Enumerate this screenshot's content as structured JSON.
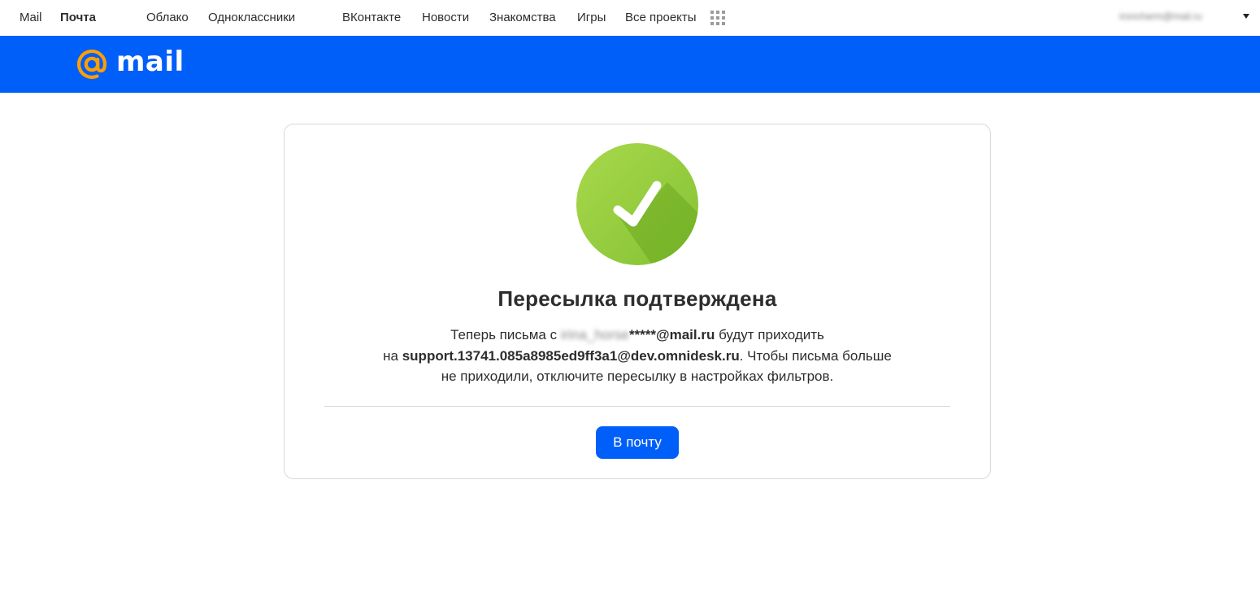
{
  "portal": {
    "links": [
      {
        "label": "Mail"
      },
      {
        "label": "Почта"
      },
      {
        "label": "Облако"
      },
      {
        "label": "Одноклассники"
      },
      {
        "label": "ВКонтакте"
      },
      {
        "label": "Новости"
      },
      {
        "label": "Знакомства"
      },
      {
        "label": "Игры"
      },
      {
        "label": "Все проекты"
      }
    ],
    "projects_icon": "grid-icon",
    "user_email": "ironcharm@mail.ru"
  },
  "header": {
    "logo_text": "mail",
    "logo_icon": "at-sign-icon",
    "bg_color": "#005ff9",
    "accent_color": "#ff9e00"
  },
  "card": {
    "status_icon": "success-check-icon",
    "status_color": "#8bc83a",
    "title": "Пересылка подтверждена",
    "line1_prefix": "Теперь письма с ",
    "source_user_blurred": "irina_horse",
    "source_masked": "*****@mail.ru",
    "line1_suffix": " будут приходить",
    "line2_prefix": "на ",
    "destination": "support.13741.085a8985ed9ff3a1@dev.omnidesk.ru",
    "line2_suffix": ". Чтобы письма больше",
    "line3": "не приходили, отключите пересылку в настройках фильтров.",
    "button_label": "В почту"
  }
}
